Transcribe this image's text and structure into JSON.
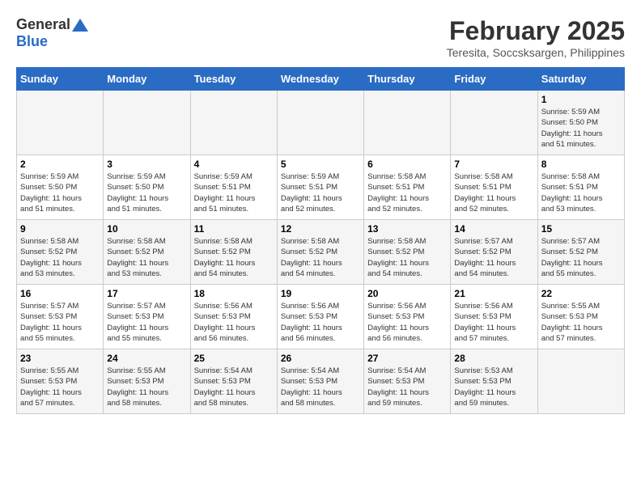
{
  "logo": {
    "general": "General",
    "blue": "Blue"
  },
  "title": "February 2025",
  "subtitle": "Teresita, Soccsksargen, Philippines",
  "days_of_week": [
    "Sunday",
    "Monday",
    "Tuesday",
    "Wednesday",
    "Thursday",
    "Friday",
    "Saturday"
  ],
  "weeks": [
    [
      {
        "day": "",
        "detail": ""
      },
      {
        "day": "",
        "detail": ""
      },
      {
        "day": "",
        "detail": ""
      },
      {
        "day": "",
        "detail": ""
      },
      {
        "day": "",
        "detail": ""
      },
      {
        "day": "",
        "detail": ""
      },
      {
        "day": "1",
        "detail": "Sunrise: 5:59 AM\nSunset: 5:50 PM\nDaylight: 11 hours\nand 51 minutes."
      }
    ],
    [
      {
        "day": "2",
        "detail": "Sunrise: 5:59 AM\nSunset: 5:50 PM\nDaylight: 11 hours\nand 51 minutes."
      },
      {
        "day": "3",
        "detail": "Sunrise: 5:59 AM\nSunset: 5:50 PM\nDaylight: 11 hours\nand 51 minutes."
      },
      {
        "day": "4",
        "detail": "Sunrise: 5:59 AM\nSunset: 5:51 PM\nDaylight: 11 hours\nand 51 minutes."
      },
      {
        "day": "5",
        "detail": "Sunrise: 5:59 AM\nSunset: 5:51 PM\nDaylight: 11 hours\nand 52 minutes."
      },
      {
        "day": "6",
        "detail": "Sunrise: 5:58 AM\nSunset: 5:51 PM\nDaylight: 11 hours\nand 52 minutes."
      },
      {
        "day": "7",
        "detail": "Sunrise: 5:58 AM\nSunset: 5:51 PM\nDaylight: 11 hours\nand 52 minutes."
      },
      {
        "day": "8",
        "detail": "Sunrise: 5:58 AM\nSunset: 5:51 PM\nDaylight: 11 hours\nand 53 minutes."
      }
    ],
    [
      {
        "day": "9",
        "detail": "Sunrise: 5:58 AM\nSunset: 5:52 PM\nDaylight: 11 hours\nand 53 minutes."
      },
      {
        "day": "10",
        "detail": "Sunrise: 5:58 AM\nSunset: 5:52 PM\nDaylight: 11 hours\nand 53 minutes."
      },
      {
        "day": "11",
        "detail": "Sunrise: 5:58 AM\nSunset: 5:52 PM\nDaylight: 11 hours\nand 54 minutes."
      },
      {
        "day": "12",
        "detail": "Sunrise: 5:58 AM\nSunset: 5:52 PM\nDaylight: 11 hours\nand 54 minutes."
      },
      {
        "day": "13",
        "detail": "Sunrise: 5:58 AM\nSunset: 5:52 PM\nDaylight: 11 hours\nand 54 minutes."
      },
      {
        "day": "14",
        "detail": "Sunrise: 5:57 AM\nSunset: 5:52 PM\nDaylight: 11 hours\nand 54 minutes."
      },
      {
        "day": "15",
        "detail": "Sunrise: 5:57 AM\nSunset: 5:52 PM\nDaylight: 11 hours\nand 55 minutes."
      }
    ],
    [
      {
        "day": "16",
        "detail": "Sunrise: 5:57 AM\nSunset: 5:53 PM\nDaylight: 11 hours\nand 55 minutes."
      },
      {
        "day": "17",
        "detail": "Sunrise: 5:57 AM\nSunset: 5:53 PM\nDaylight: 11 hours\nand 55 minutes."
      },
      {
        "day": "18",
        "detail": "Sunrise: 5:56 AM\nSunset: 5:53 PM\nDaylight: 11 hours\nand 56 minutes."
      },
      {
        "day": "19",
        "detail": "Sunrise: 5:56 AM\nSunset: 5:53 PM\nDaylight: 11 hours\nand 56 minutes."
      },
      {
        "day": "20",
        "detail": "Sunrise: 5:56 AM\nSunset: 5:53 PM\nDaylight: 11 hours\nand 56 minutes."
      },
      {
        "day": "21",
        "detail": "Sunrise: 5:56 AM\nSunset: 5:53 PM\nDaylight: 11 hours\nand 57 minutes."
      },
      {
        "day": "22",
        "detail": "Sunrise: 5:55 AM\nSunset: 5:53 PM\nDaylight: 11 hours\nand 57 minutes."
      }
    ],
    [
      {
        "day": "23",
        "detail": "Sunrise: 5:55 AM\nSunset: 5:53 PM\nDaylight: 11 hours\nand 57 minutes."
      },
      {
        "day": "24",
        "detail": "Sunrise: 5:55 AM\nSunset: 5:53 PM\nDaylight: 11 hours\nand 58 minutes."
      },
      {
        "day": "25",
        "detail": "Sunrise: 5:54 AM\nSunset: 5:53 PM\nDaylight: 11 hours\nand 58 minutes."
      },
      {
        "day": "26",
        "detail": "Sunrise: 5:54 AM\nSunset: 5:53 PM\nDaylight: 11 hours\nand 58 minutes."
      },
      {
        "day": "27",
        "detail": "Sunrise: 5:54 AM\nSunset: 5:53 PM\nDaylight: 11 hours\nand 59 minutes."
      },
      {
        "day": "28",
        "detail": "Sunrise: 5:53 AM\nSunset: 5:53 PM\nDaylight: 11 hours\nand 59 minutes."
      },
      {
        "day": "",
        "detail": ""
      }
    ]
  ]
}
